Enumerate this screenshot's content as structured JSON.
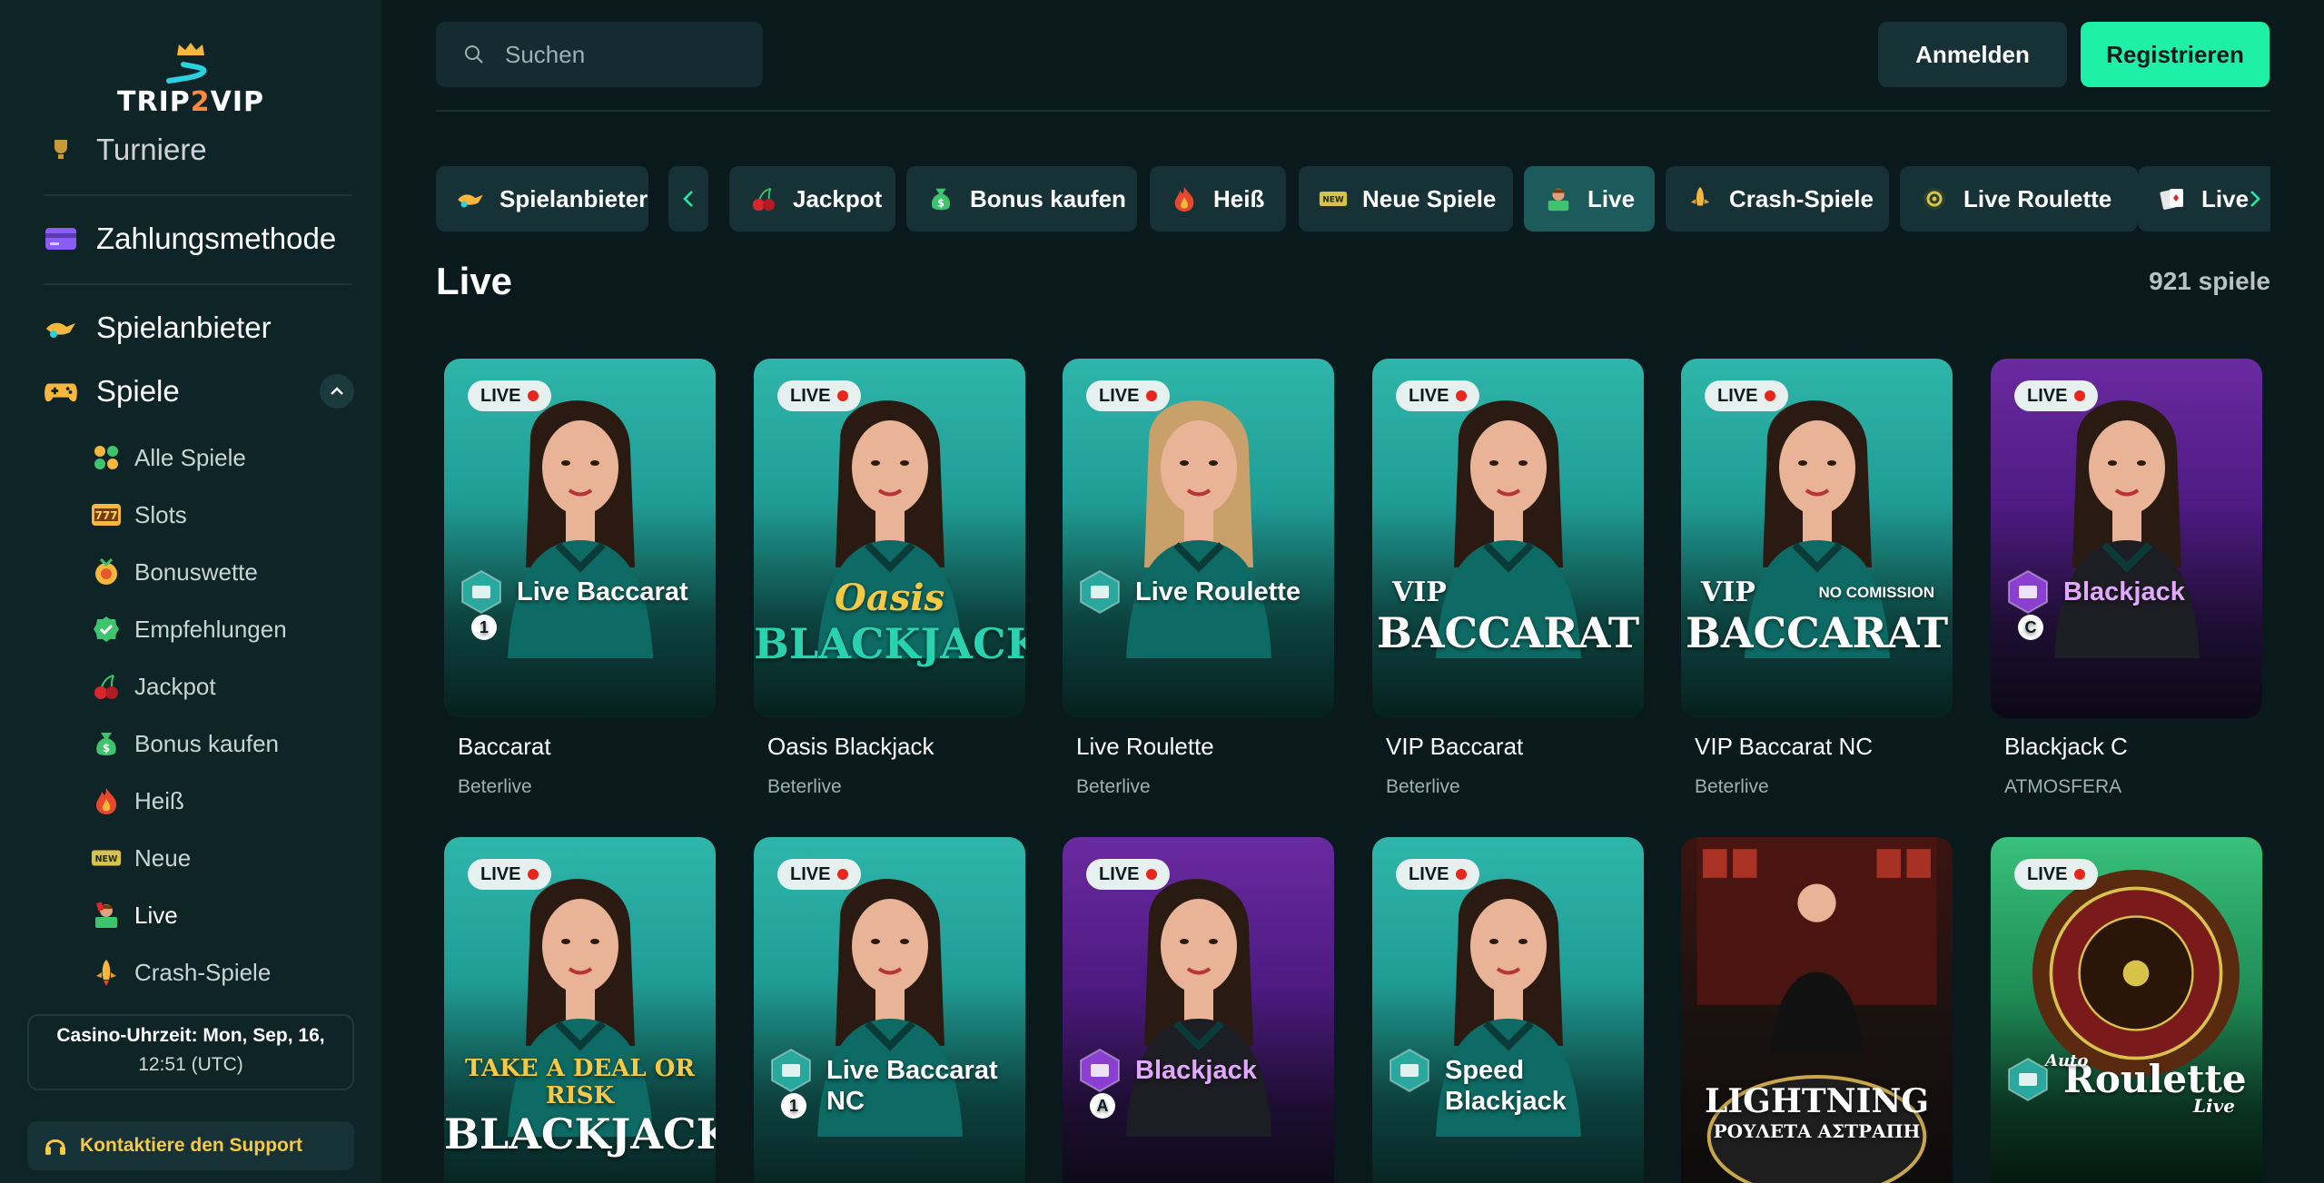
{
  "app": {
    "logo_text_a": "TRIP",
    "logo_text_b": "2",
    "logo_text_c": "VIP"
  },
  "sidebar": {
    "top_items": [
      {
        "label": "Turniere",
        "icon": "trophy-icon"
      },
      {
        "label": "Zahlungsmethode",
        "icon": "credit-card-icon"
      },
      {
        "label": "Spielanbieter",
        "icon": "provider-icon"
      },
      {
        "label": "Spiele",
        "icon": "gamepad-icon"
      }
    ],
    "sub_items": [
      {
        "label": "Alle Spiele",
        "icon": "grid-icon"
      },
      {
        "label": "Slots",
        "icon": "slots-777-icon"
      },
      {
        "label": "Bonuswette",
        "icon": "bonus-bet-icon"
      },
      {
        "label": "Empfehlungen",
        "icon": "recommend-check-icon"
      },
      {
        "label": "Jackpot",
        "icon": "cherries-icon"
      },
      {
        "label": "Bonus kaufen",
        "icon": "money-bag-icon"
      },
      {
        "label": "Heiß",
        "icon": "fire-icon"
      },
      {
        "label": "Neue",
        "icon": "new-badge-icon"
      },
      {
        "label": "Live",
        "icon": "live-dealer-icon"
      },
      {
        "label": "Crash-Spiele",
        "icon": "rocket-icon"
      }
    ],
    "clock_line1": "Casino-Uhrzeit: Mon, Sep, 16,",
    "clock_line2": "12:51 (UTC)",
    "support_label": "Kontaktiere den Support"
  },
  "header": {
    "search_placeholder": "Suchen",
    "login_label": "Anmelden",
    "register_label": "Registrieren"
  },
  "categories": [
    {
      "label": "Spielanbieter",
      "icon": "provider-icon"
    },
    {
      "label": "Jackpot",
      "icon": "cherries-icon"
    },
    {
      "label": "Bonus kaufen",
      "icon": "money-bag-icon"
    },
    {
      "label": "Heiß",
      "icon": "fire-icon"
    },
    {
      "label": "Neue Spiele",
      "icon": "new-badge-icon"
    },
    {
      "label": "Live",
      "icon": "live-dealer-icon",
      "active": true
    },
    {
      "label": "Crash-Spiele",
      "icon": "rocket-icon"
    },
    {
      "label": "Live Roulette",
      "icon": "roulette-chip-icon"
    },
    {
      "label": "Live",
      "icon": "cards-icon"
    }
  ],
  "main": {
    "title": "Live",
    "count": "921 spiele"
  },
  "live_badge": "LIVE",
  "games": [
    {
      "title": "Baccarat",
      "provider": "Beterlive",
      "art": "Live Baccarat",
      "art_sub": "1",
      "theme": "teal"
    },
    {
      "title": "Oasis Blackjack",
      "provider": "Beterlive",
      "art": "Oasis",
      "art_sub": "BLACKJACK",
      "theme": "teal"
    },
    {
      "title": "Live Roulette",
      "provider": "Beterlive",
      "art": "Live Roulette",
      "art_sub": "",
      "theme": "teal"
    },
    {
      "title": "VIP Baccarat",
      "provider": "Beterlive",
      "art": "VIP",
      "art_sub": "BACCARAT",
      "theme": "teal"
    },
    {
      "title": "VIP Baccarat NC",
      "provider": "Beterlive",
      "art": "VIP",
      "art_sub": "BACCARAT",
      "art_note": "NO COMISSION",
      "theme": "teal"
    },
    {
      "title": "Blackjack C",
      "provider": "ATMOSFERA",
      "art": "Blackjack",
      "art_sub": "C",
      "theme": "purple"
    },
    {
      "title": "",
      "provider": "",
      "art": "TAKE A DEAL OR RISK",
      "art_sub": "BLACKJACK",
      "theme": "teal"
    },
    {
      "title": "",
      "provider": "",
      "art": "Live Baccarat NC",
      "art_sub": "1",
      "theme": "teal"
    },
    {
      "title": "",
      "provider": "",
      "art": "Blackjack",
      "art_sub": "A",
      "theme": "purple"
    },
    {
      "title": "",
      "provider": "",
      "art": "Speed Blackjack",
      "art_sub": "",
      "theme": "teal"
    },
    {
      "title": "",
      "provider": "",
      "art": "LIGHTNING",
      "art_sub": "ΡΟΥΛΕΤΑ ΑΣΤΡΑΠΗ",
      "theme": "dark"
    },
    {
      "title": "",
      "provider": "",
      "art": "Roulette",
      "art_sub": "Live",
      "art_note": "Auto",
      "theme": "green"
    }
  ],
  "colors": {
    "accent": "#1ff0a8",
    "support_text": "#f6c945",
    "live_dot": "#e8261c"
  }
}
